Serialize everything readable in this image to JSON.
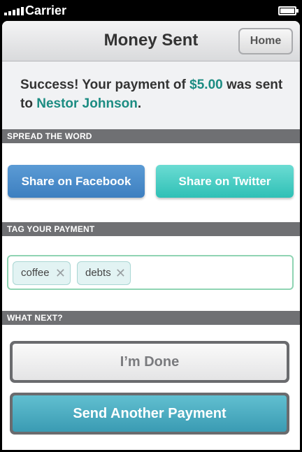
{
  "status_bar": {
    "carrier": "Carrier"
  },
  "nav": {
    "title": "Money Sent",
    "home_label": "Home"
  },
  "message": {
    "prefix": "Success! Your payment of ",
    "amount": "$5.00",
    "middle": " was sent to ",
    "recipient": "Nestor Johnson",
    "suffix": "."
  },
  "spread": {
    "header": "SPREAD THE WORD",
    "facebook_label": "Share on Facebook",
    "twitter_label": "Share on Twitter"
  },
  "tags": {
    "header": "TAG YOUR PAYMENT",
    "items": [
      {
        "label": "coffee",
        "remove": "✕"
      },
      {
        "label": "debts",
        "remove": "✕"
      }
    ]
  },
  "next": {
    "header": "WHAT NEXT?",
    "done_label": "I’m Done",
    "send_label": "Send Another Payment"
  },
  "colors": {
    "accent": "#1c8c82",
    "facebook": "#4a8ccb",
    "twitter": "#3ccbc1",
    "section_header": "#6f7073"
  }
}
